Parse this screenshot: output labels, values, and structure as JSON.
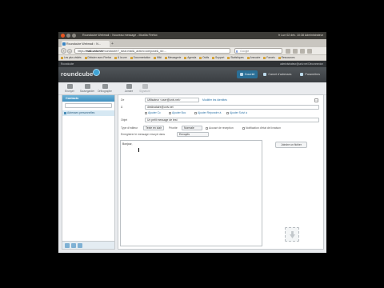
{
  "os": {
    "window_title": "Roundcube Webmail :: Nouveau message - Mozilla Firefox",
    "tray": "fr  Lun 02 déc. 10:38  Administrateur"
  },
  "browser": {
    "tab_title": "Roundcube Webmail :: N...",
    "new_tab": "+",
    "url_prefix": "https://",
    "url_domain": "mail.univ.net",
    "url_rest": "/roundcube/?_task=mail&_action=compose&_id=...",
    "search_placeholder": "Google",
    "bookmarks": [
      "Les plus visités",
      "Débuter avec Firefox",
      "À la une",
      "Documentation",
      "Wiki",
      "Messagerie",
      "Agenda",
      "Outils",
      "Support",
      "Statistiques",
      "Annuaire",
      "Favoris",
      "Ressources"
    ]
  },
  "rc": {
    "header_left": "Roundcube",
    "header_right": "administrateur@univ.net   Déconnexion",
    "logo": "roundcube",
    "nav": {
      "mail": "Courriel",
      "contacts": "Carnet d'adresses",
      "settings": "Paramètres"
    },
    "toolbar": {
      "send": "Envoyer",
      "save": "Sauvegarder",
      "spell": "Orthographe",
      "attach": "Joindre",
      "signature": "Signature"
    }
  },
  "contacts": {
    "title": "Contacts",
    "search_placeholder": "",
    "items": [
      "Adresses personnelles"
    ]
  },
  "compose": {
    "from_label": "De",
    "from_value": "Utilisateur <user@univ.net>",
    "edit_identities": "Modifier les identités",
    "to_label": "À",
    "to_value": "destinataire@univ.net",
    "add_cc": "Ajouter Cc",
    "add_bcc": "Ajouter Bcc",
    "add_reply_to": "Ajouter Répondre à",
    "add_followup": "Ajouter Suivi à",
    "subject_label": "Objet",
    "subject_value": "Un petit message de test",
    "editor_type_label": "Type d'éditeur",
    "editor_type_value": "Texte en clair",
    "priority_label": "Priorité",
    "priority_value": "Normale",
    "receipt_label": "Accusé de réception",
    "dsn_label": "Notification d'état de livraison",
    "save_sent_label": "Enregistrer le message envoyé dans",
    "save_sent_value": "Envoyés",
    "body_label": "Bonjour,",
    "attach_button": "Joindre un fichier"
  }
}
